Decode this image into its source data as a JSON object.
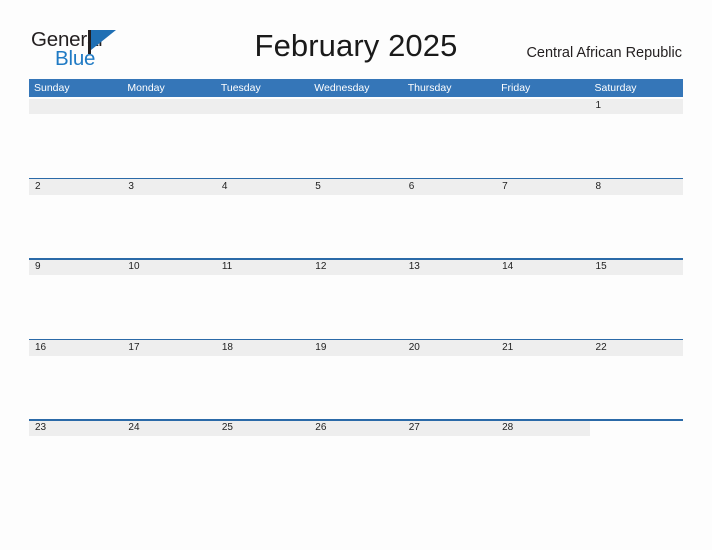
{
  "brand": {
    "name_top": "General",
    "name_bottom": "Blue",
    "flag_icon": "blue-flag-icon",
    "color_dark": "#231f20",
    "color_blue": "#1f7ac4"
  },
  "calendar": {
    "title": "February 2025",
    "month": "February",
    "year": "2025",
    "region": "Central African Republic",
    "header_color": "#3576b8",
    "band_color": "#eeeeee",
    "rule_color": "#2b6aa8",
    "weekdays": [
      "Sunday",
      "Monday",
      "Tuesday",
      "Wednesday",
      "Thursday",
      "Friday",
      "Saturday"
    ],
    "weeks": [
      [
        "",
        "",
        "",
        "",
        "",
        "",
        "1"
      ],
      [
        "2",
        "3",
        "4",
        "5",
        "6",
        "7",
        "8"
      ],
      [
        "9",
        "10",
        "11",
        "12",
        "13",
        "14",
        "15"
      ],
      [
        "16",
        "17",
        "18",
        "19",
        "20",
        "21",
        "22"
      ],
      [
        "23",
        "24",
        "25",
        "26",
        "27",
        "28",
        ""
      ]
    ],
    "week_band_spans": [
      7,
      7,
      7,
      7,
      6
    ]
  }
}
